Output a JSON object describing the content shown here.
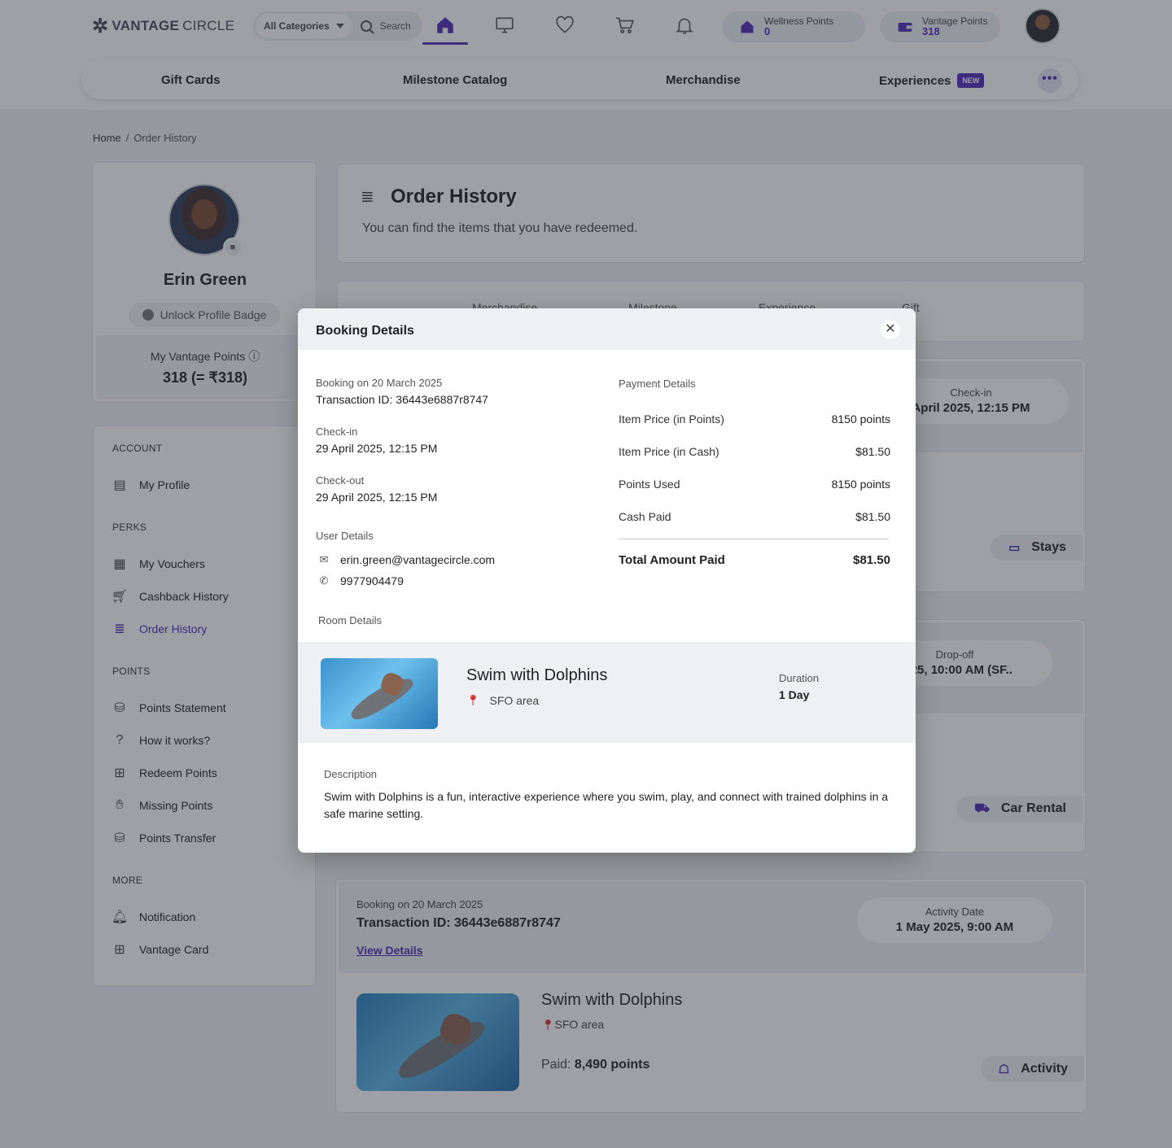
{
  "header": {
    "logo_left": "VANTAGE",
    "logo_right": "CIRCLE",
    "category_select": "All Categories",
    "search_placeholder": "Search",
    "wellness_points": {
      "label": "Wellness Points",
      "value": "0"
    },
    "vantage_points": {
      "label": "Vantage Points",
      "value": "318"
    },
    "icons": [
      "home-icon",
      "monitor-icon",
      "heart-icon",
      "cart-icon",
      "bell-icon"
    ]
  },
  "categories": [
    {
      "label": "Gift Cards"
    },
    {
      "label": "Milestone Catalog"
    },
    {
      "label": "Merchandise"
    },
    {
      "label": "Experiences",
      "badge": "NEW"
    }
  ],
  "breadcrumb": {
    "home": "Home",
    "separator": "/",
    "current": "Order History"
  },
  "profile": {
    "name": "Erin Green",
    "badge_button": "Unlock Profile Badge",
    "points_label": "My Vantage Points",
    "points_value": "318 (= ₹318)"
  },
  "sidebar": {
    "sections": [
      {
        "title": "ACCOUNT",
        "items": [
          {
            "label": "My Profile",
            "icon": "profile-icon"
          }
        ]
      },
      {
        "title": "PERKS",
        "items": [
          {
            "label": "My Vouchers",
            "icon": "voucher-icon"
          },
          {
            "label": "Cashback History",
            "icon": "cart-icon"
          },
          {
            "label": "Order History",
            "icon": "order-history-icon",
            "active": true
          }
        ]
      },
      {
        "title": "POINTS",
        "items": [
          {
            "label": "Points Statement",
            "icon": "coins-icon"
          },
          {
            "label": "How it works?",
            "icon": "question-icon"
          },
          {
            "label": "Redeem Points",
            "icon": "gift-icon"
          },
          {
            "label": "Missing Points",
            "icon": "hand-icon"
          },
          {
            "label": "Points Transfer",
            "icon": "coins-icon"
          }
        ]
      },
      {
        "title": "MORE",
        "items": [
          {
            "label": "Notification",
            "icon": "bell-icon"
          },
          {
            "label": "Vantage Card",
            "icon": "gift-icon"
          }
        ]
      }
    ]
  },
  "main": {
    "title": "Order History",
    "subtitle": "You can find the items that you have redeemed.",
    "tabs": [
      "Merchandise",
      "Milestone",
      "Experience",
      "Gift"
    ],
    "orders": [
      {
        "date_label": "Check-in",
        "date_value": "April 2025, 12:15 PM",
        "type": "Stays"
      },
      {
        "date_label": "Drop-off",
        "date_value": "2025, 10:00 AM (SF..",
        "type": "Car Rental"
      },
      {
        "booking": "Booking on 20 March 2025",
        "transaction": "Transaction ID: 36443e6887r8747",
        "view_details": "View Details",
        "date_label": "Activity Date",
        "date_value": "1 May 2025, 9:00 AM",
        "title": "Swim with Dolphins",
        "location": "SFO area",
        "paid_label": "Paid:",
        "paid_value": "8,490 points",
        "type": "Activity"
      }
    ]
  },
  "modal": {
    "title": "Booking Details",
    "booking": "Booking on 20 March 2025",
    "transaction": "Transaction ID: 36443e6887r8747",
    "checkin_label": "Check-in",
    "checkin_value": "29 April 2025, 12:15 PM",
    "checkout_label": "Check-out",
    "checkout_value": "29 April 2025, 12:15 PM",
    "user_details_label": "User Details",
    "email": "erin.green@vantagecircle.com",
    "phone": "9977904479",
    "payment_label": "Payment Details",
    "payment_rows": [
      {
        "label": "Item Price (in Points)",
        "value": "8150 points"
      },
      {
        "label": "Item Price (in Cash)",
        "value": "$81.50"
      },
      {
        "label": "Points Used",
        "value": "8150 points"
      },
      {
        "label": "Cash Paid",
        "value": "$81.50"
      }
    ],
    "total_label": "Total Amount Paid",
    "total_value": "$81.50",
    "room_details_label": "Room Details",
    "room": {
      "name": "Swim with Dolphins",
      "location": "SFO area",
      "duration_label": "Duration",
      "duration_value": "1 Day"
    },
    "description_label": "Description",
    "description": "Swim with Dolphins is a fun, interactive experience where you swim, play, and connect with trained dolphins in a safe marine setting."
  },
  "colors": {
    "accent": "#4f2bb5",
    "pin": "#d0312d",
    "overlay": "rgba(40,44,56,0.45)"
  }
}
